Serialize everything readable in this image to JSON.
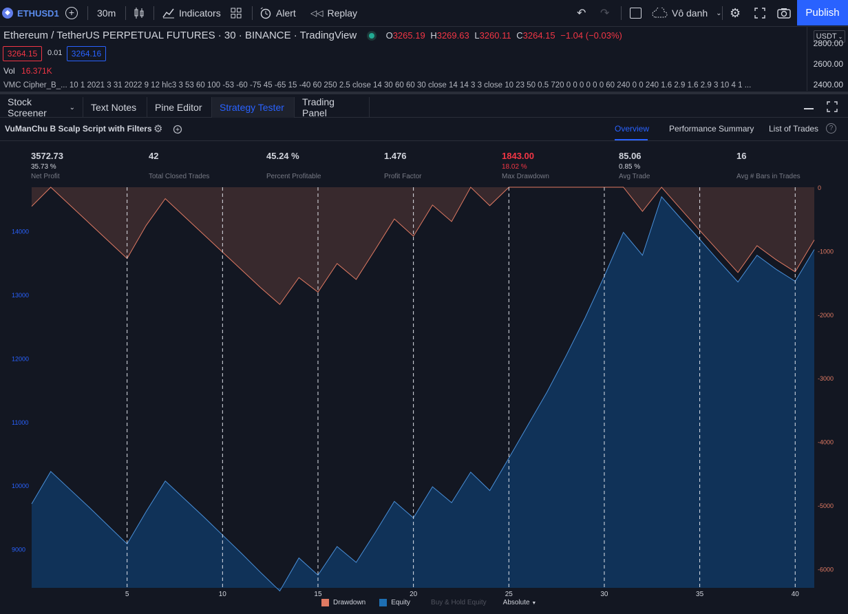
{
  "toolbar": {
    "symbol": "ETHUSD1",
    "interval": "30m",
    "indicators": "Indicators",
    "alert": "Alert",
    "replay": "Replay",
    "layout_name": "Vô danh",
    "publish": "Publish"
  },
  "header": {
    "symbol_line": "Ethereum / TetherUS PERPETUAL FUTURES · 30 · BINANCE · TradingView",
    "o_label": "O",
    "o": "3265.19",
    "h_label": "H",
    "h": "3269.63",
    "l_label": "L",
    "l": "3260.11",
    "c_label": "C",
    "c": "3264.15",
    "change": "−1.04 (−0.03%)",
    "bid": "3264.15",
    "spread": "0.01",
    "ask": "3264.16",
    "vol_label": "Vol",
    "vol_value": "16.371K",
    "indicator_line": "VMC Cipher_B_...   10 1 2021 3 31 2022 9 12 hlc3 3 53 60 100 -53 -60 -75 45 -65 15 -40 60 250 2.5 close 14 30 60 60 30 close 14 14 3 3 close 10 23 50 0.5 720 0 0 0 0 0 0 60 240 0 0 240 1.6 2.9 1.6 2.9 3 10 4 1 ...",
    "currency": "USDT",
    "price_ticks": [
      "2800.00",
      "2600.00",
      "2400.00"
    ]
  },
  "tabs": [
    "Stock Screener",
    "Text Notes",
    "Pine Editor",
    "Strategy Tester",
    "Trading Panel"
  ],
  "active_tab": "Strategy Tester",
  "strategy": {
    "name": "VuManChu B Scalp Script with Filters",
    "subtabs": [
      "Overview",
      "Performance Summary",
      "List of Trades"
    ],
    "active_subtab": "Overview"
  },
  "stats": [
    {
      "value": "3572.73",
      "pct": "35.73 %",
      "label": "Net Profit"
    },
    {
      "value": "42",
      "pct": "",
      "label": "Total Closed Trades"
    },
    {
      "value": "45.24 %",
      "pct": "",
      "label": "Percent Profitable"
    },
    {
      "value": "1.476",
      "pct": "",
      "label": "Profit Factor"
    },
    {
      "value": "1843.00",
      "pct": "18.02 %",
      "label": "Max Drawdown"
    },
    {
      "value": "85.06",
      "pct": "0.85 %",
      "label": "Avg Trade"
    },
    {
      "value": "16",
      "pct": "",
      "label": "Avg # Bars in Trades"
    }
  ],
  "legend": {
    "drawdown": "Drawdown",
    "equity": "Equity",
    "buyhold": "Buy & Hold Equity",
    "mode": "Absolute"
  },
  "colors": {
    "drawdown": "#f7525f",
    "equity": "#2196f3",
    "accent": "#2962ff",
    "background": "#131722"
  },
  "chart_data": {
    "type": "area",
    "x": [
      0,
      1,
      2,
      3,
      4,
      5,
      6,
      7,
      8,
      9,
      10,
      11,
      12,
      13,
      14,
      15,
      16,
      17,
      18,
      19,
      20,
      21,
      22,
      23,
      24,
      25,
      26,
      27,
      28,
      29,
      30,
      31,
      32,
      33,
      34,
      35,
      36,
      37,
      38,
      39,
      40,
      41
    ],
    "x_ticks": [
      "5",
      "10",
      "15",
      "20",
      "25",
      "30",
      "35",
      "40"
    ],
    "equity_ticks": [
      "14000",
      "13000",
      "12000",
      "11000",
      "10000",
      "9000"
    ],
    "drawdown_ticks": [
      "0",
      "-1000",
      "-2000",
      "-3000",
      "-4000",
      "-5000",
      "-6000"
    ],
    "series": [
      {
        "name": "Equity",
        "axis": "left",
        "values": [
          9720,
          10230,
          9950,
          9670,
          9380,
          9090,
          9600,
          10080,
          9800,
          9520,
          9230,
          8940,
          8640,
          8350,
          8870,
          8600,
          9050,
          8800,
          9270,
          9760,
          9500,
          9990,
          9740,
          10220,
          9930,
          10440,
          10960,
          11480,
          12050,
          12650,
          13300,
          13990,
          13630,
          14550,
          14210,
          13880,
          13540,
          13210,
          13630,
          13410,
          13220,
          13720
        ]
      },
      {
        "name": "Drawdown",
        "axis": "right",
        "values": [
          -300,
          0,
          -280,
          -560,
          -840,
          -1120,
          -600,
          -180,
          -460,
          -740,
          -1020,
          -1300,
          -1580,
          -1843,
          -1420,
          -1650,
          -1200,
          -1450,
          -980,
          -500,
          -770,
          -280,
          -540,
          0,
          -290,
          0,
          0,
          0,
          0,
          0,
          0,
          0,
          -380,
          0,
          -340,
          -680,
          -1010,
          -1340,
          -920,
          -1140,
          -1330,
          -830
        ]
      }
    ],
    "ylim_left": [
      8400,
      14700
    ],
    "ylim_right": [
      -6300,
      0
    ],
    "xlim": [
      0,
      41
    ],
    "grid": false,
    "legend_position": "bottom-center"
  }
}
